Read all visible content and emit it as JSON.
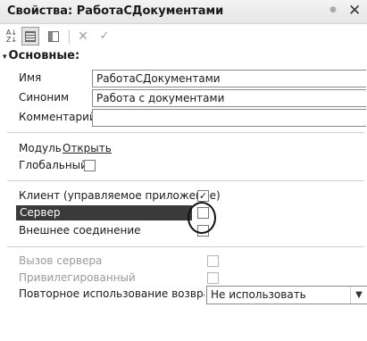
{
  "window": {
    "title": "Свойства: РаботаСДокументами",
    "pin_icon": "pin-icon",
    "close_icon": "✕"
  },
  "toolbar": {
    "sort_icon": "alphabetical-sort-icon",
    "sort_top": "A↓",
    "sort_bottom": "Z↓",
    "categories_icon": "categories-icon",
    "filter_icon": "filter-icon",
    "cancel_glyph": "✕",
    "ok_glyph": "✓"
  },
  "section": {
    "arrow": "▾",
    "title": "Основные:"
  },
  "fields": {
    "name_label": "Имя",
    "name_value": "РаботаСДокументами",
    "synonym_label": "Синоним",
    "synonym_value": "Работа с документами",
    "comment_label": "Комментарий",
    "comment_value": ""
  },
  "module": {
    "label": "Модуль",
    "link": "Открыть",
    "global_label": "Глобальный",
    "global_checked": false
  },
  "contexts": {
    "client_label": "Клиент (управляемое приложение)",
    "client_checked": true,
    "server_label": "Сервер",
    "server_checked": false,
    "external_label": "Внешнее соединение",
    "external_checked": false
  },
  "server_props": {
    "server_call_label": "Вызов сервера",
    "privileged_label": "Привилегированный",
    "reuse_label": "Повторное использование возвращаемых значений",
    "reuse_value": "Не использовать",
    "dropdown_glyph": "▼"
  },
  "colors": {
    "selection": "#3a3a3a",
    "titlebar": "#ececec",
    "annotation": "#111111"
  }
}
